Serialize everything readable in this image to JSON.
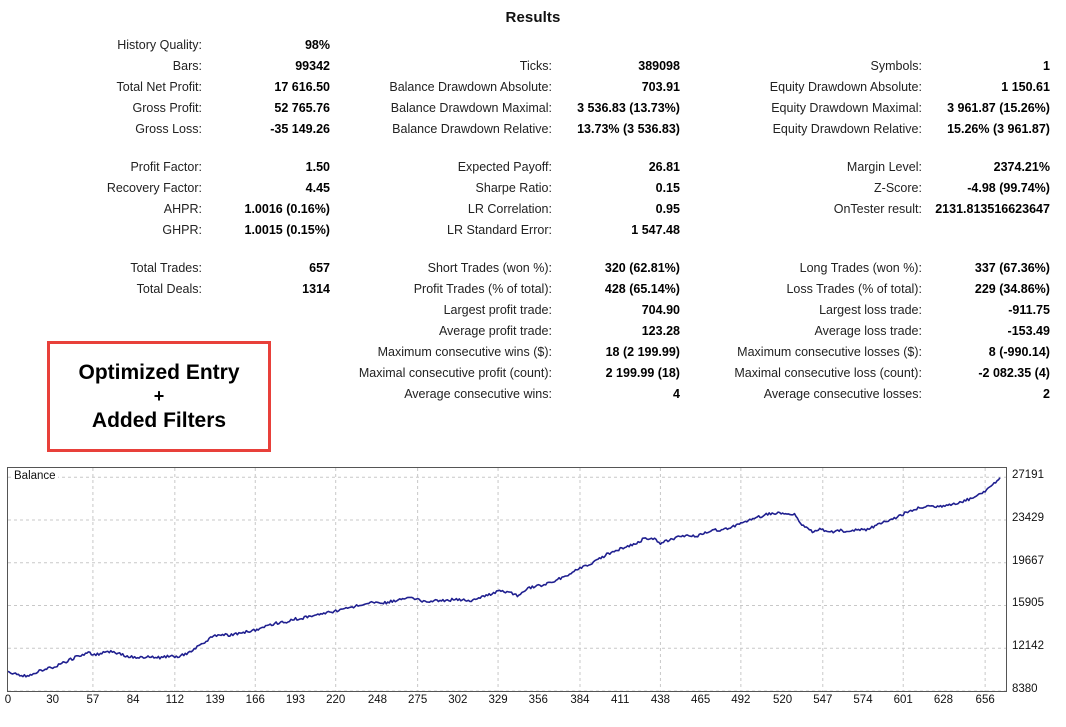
{
  "title": "Results",
  "annotation": {
    "line1": "Optimized Entry",
    "plus": "+",
    "line2": "Added Filters",
    "border_color": "#e8403a"
  },
  "stats": {
    "block1": {
      "col1": [
        {
          "label": "History Quality:",
          "value": "98%"
        },
        {
          "label": "Bars:",
          "value": "99342"
        },
        {
          "label": "Total Net Profit:",
          "value": "17 616.50"
        },
        {
          "label": "Gross Profit:",
          "value": "52 765.76"
        },
        {
          "label": "Gross Loss:",
          "value": "-35 149.26"
        }
      ],
      "col2": [
        {
          "label": "",
          "value": ""
        },
        {
          "label": "Ticks:",
          "value": "389098"
        },
        {
          "label": "Balance Drawdown Absolute:",
          "value": "703.91"
        },
        {
          "label": "Balance Drawdown Maximal:",
          "value": "3 536.83 (13.73%)"
        },
        {
          "label": "Balance Drawdown Relative:",
          "value": "13.73% (3 536.83)"
        }
      ],
      "col3": [
        {
          "label": "",
          "value": ""
        },
        {
          "label": "Symbols:",
          "value": "1"
        },
        {
          "label": "Equity Drawdown Absolute:",
          "value": "1 150.61"
        },
        {
          "label": "Equity Drawdown Maximal:",
          "value": "3 961.87 (15.26%)"
        },
        {
          "label": "Equity Drawdown Relative:",
          "value": "15.26% (3 961.87)"
        }
      ]
    },
    "block2": {
      "col1": [
        {
          "label": "Profit Factor:",
          "value": "1.50"
        },
        {
          "label": "Recovery Factor:",
          "value": "4.45"
        },
        {
          "label": "AHPR:",
          "value": "1.0016 (0.16%)"
        },
        {
          "label": "GHPR:",
          "value": "1.0015 (0.15%)"
        }
      ],
      "col2": [
        {
          "label": "Expected Payoff:",
          "value": "26.81"
        },
        {
          "label": "Sharpe Ratio:",
          "value": "0.15"
        },
        {
          "label": "LR Correlation:",
          "value": "0.95"
        },
        {
          "label": "LR Standard Error:",
          "value": "1 547.48"
        }
      ],
      "col3": [
        {
          "label": "Margin Level:",
          "value": "2374.21%"
        },
        {
          "label": "Z-Score:",
          "value": "-4.98 (99.74%)"
        },
        {
          "label": "OnTester result:",
          "value": "2131.813516623647"
        },
        {
          "label": "",
          "value": ""
        }
      ]
    },
    "block3": {
      "col1": [
        {
          "label": "Total Trades:",
          "value": "657"
        },
        {
          "label": "Total Deals:",
          "value": "1314"
        },
        {
          "label": "",
          "value": ""
        },
        {
          "label": "",
          "value": ""
        },
        {
          "label": "",
          "value": ""
        },
        {
          "label": "",
          "value": ""
        },
        {
          "label": "",
          "value": ""
        }
      ],
      "col2": [
        {
          "label": "Short Trades (won %):",
          "value": "320 (62.81%)"
        },
        {
          "label": "Profit Trades (% of total):",
          "value": "428 (65.14%)"
        },
        {
          "label": "Largest profit trade:",
          "value": "704.90"
        },
        {
          "label": "Average profit trade:",
          "value": "123.28"
        },
        {
          "label": "Maximum consecutive wins ($):",
          "value": "18 (2 199.99)"
        },
        {
          "label": "Maximal consecutive profit (count):",
          "value": "2 199.99 (18)"
        },
        {
          "label": "Average consecutive wins:",
          "value": "4"
        }
      ],
      "col3": [
        {
          "label": "Long Trades (won %):",
          "value": "337 (67.36%)"
        },
        {
          "label": "Loss Trades (% of total):",
          "value": "229 (34.86%)"
        },
        {
          "label": "Largest loss trade:",
          "value": "-911.75"
        },
        {
          "label": "Average loss trade:",
          "value": "-153.49"
        },
        {
          "label": "Maximum consecutive losses ($):",
          "value": "8 (-990.14)"
        },
        {
          "label": "Maximal consecutive loss (count):",
          "value": "-2 082.35 (4)"
        },
        {
          "label": "Average consecutive losses:",
          "value": "2"
        }
      ]
    }
  },
  "chart_data": {
    "type": "line",
    "title": "",
    "legend": "Balance",
    "legend_position": "top-left",
    "xlabel": "",
    "ylabel": "",
    "grid": true,
    "line_color": "#202090",
    "xlim": [
      0,
      670
    ],
    "ylim": [
      8380,
      28000
    ],
    "xticks": [
      0,
      30,
      57,
      84,
      112,
      139,
      166,
      193,
      220,
      248,
      275,
      302,
      329,
      356,
      384,
      411,
      438,
      465,
      492,
      520,
      547,
      574,
      601,
      628,
      656
    ],
    "yticks": [
      27191,
      23429,
      19667,
      15905,
      12142,
      8380
    ],
    "series": [
      {
        "name": "Balance",
        "x": [
          0,
          6,
          12,
          18,
          24,
          30,
          36,
          42,
          48,
          54,
          60,
          66,
          72,
          78,
          84,
          90,
          96,
          102,
          108,
          114,
          120,
          126,
          132,
          138,
          144,
          150,
          156,
          162,
          168,
          174,
          180,
          186,
          192,
          198,
          204,
          210,
          216,
          222,
          228,
          234,
          240,
          246,
          252,
          258,
          264,
          270,
          276,
          282,
          288,
          294,
          300,
          306,
          312,
          318,
          324,
          330,
          336,
          342,
          348,
          354,
          360,
          366,
          372,
          378,
          384,
          390,
          396,
          402,
          408,
          414,
          420,
          426,
          432,
          438,
          444,
          450,
          456,
          462,
          468,
          474,
          480,
          486,
          492,
          498,
          504,
          510,
          516,
          522,
          528,
          534,
          540,
          546,
          552,
          558,
          564,
          570,
          576,
          582,
          588,
          594,
          600,
          606,
          612,
          618,
          624,
          630,
          636,
          642,
          648,
          654,
          660,
          666
        ],
        "y": [
          10000,
          9820,
          9700,
          9980,
          10250,
          10450,
          10800,
          11150,
          11500,
          11720,
          11600,
          11900,
          11750,
          11500,
          11350,
          11400,
          11380,
          11300,
          11450,
          11400,
          11700,
          12200,
          12700,
          13250,
          13350,
          13300,
          13450,
          13650,
          13800,
          14100,
          14350,
          14450,
          14700,
          14800,
          15000,
          15150,
          15300,
          15450,
          15700,
          15850,
          16000,
          16180,
          16100,
          16300,
          16450,
          16550,
          16400,
          16200,
          16350,
          16300,
          16450,
          16400,
          16350,
          16600,
          16900,
          17200,
          17100,
          16750,
          17350,
          17600,
          17750,
          18050,
          18350,
          18750,
          19150,
          19450,
          19900,
          20400,
          20750,
          21000,
          21250,
          21700,
          21900,
          21400,
          21650,
          21900,
          22150,
          22000,
          22350,
          22600,
          22500,
          22850,
          23100,
          23400,
          23700,
          23950,
          24050,
          24000,
          23950,
          22850,
          22400,
          22650,
          22300,
          22550,
          22400,
          22600,
          22500,
          22900,
          23250,
          23500,
          23900,
          24200,
          24500,
          24650,
          24600,
          24750,
          24900,
          25100,
          25400,
          25800,
          26400,
          27150
        ]
      }
    ]
  }
}
